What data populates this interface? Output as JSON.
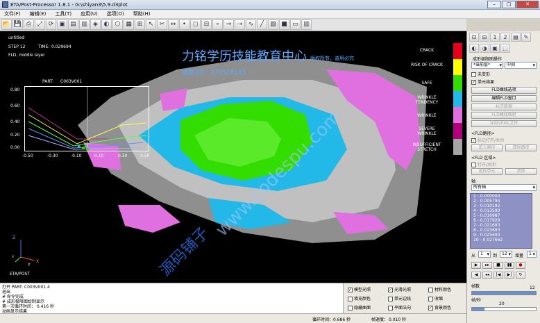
{
  "title": "ETA/Post-Processor 1.8.1 - G:\\shiyan3\\5.9.d3plot",
  "menu": [
    "文件(F)",
    "编辑(E)",
    "工具(T)",
    "应用(U)",
    "选项(O)",
    "帮助(H)"
  ],
  "toolbar_icons": [
    "open-icon",
    "save-icon",
    "print-icon",
    "zoom-fit-icon",
    "rotate-icon",
    "view-front-icon",
    "view-top-icon",
    "view-side-icon",
    "iso-view-icon",
    "shade-icon",
    "wireframe-icon",
    "grid-icon",
    "mesh-icon",
    "select-icon",
    "cut-icon",
    "measure-icon",
    "node-icon",
    "element-icon",
    "section-icon",
    "node2-icon",
    "vector-icon",
    "arrow-icon",
    "curve-icon",
    "line-icon",
    "fringe-icon",
    "color-icon",
    "plot-icon",
    "chart-icon"
  ],
  "viewport": {
    "model_name": "untitled",
    "step_label": "STEP 12",
    "time_label": "TIME:",
    "time_value": "0.029694",
    "result_label": "FLD, middle layer",
    "part_label": "PART:",
    "part_value": "C003V001",
    "axis_z": "Z",
    "axis_x": "X",
    "axis_y": "Y",
    "brand": "ETA/POST"
  },
  "fld_ticks_y": [
    "0.80",
    "0.60",
    "0.40",
    "0.20",
    "0.00"
  ],
  "fld_ticks_x": [
    "-0.50",
    "-0.30",
    "-0.10",
    "0.10",
    "0.30",
    "0.50"
  ],
  "legend": [
    {
      "label": "CRACK",
      "color": "#e8001a"
    },
    {
      "label": "RISK OF CRACK",
      "color": "#ffff00"
    },
    {
      "label": "SAFE",
      "color": "#33dd00"
    },
    {
      "label": "WRINKLE TENDENCY",
      "color": "#22b8e8"
    },
    {
      "label": "WRINKLE",
      "color": "#e070e0"
    },
    {
      "label": "SEVERE WRINKLE",
      "color": "#b0007a"
    },
    {
      "label": "INSUFFICIENT STRETCH",
      "color": "#a5a5a5"
    }
  ],
  "watermark": {
    "line1": "力铭学历技能教育中心",
    "line2": "销售QQ：470528185",
    "line3": "版权所有，盗用必究",
    "diag1": "www.codespu.com",
    "diag2": "源码铺子"
  },
  "right_panel": {
    "section_title": "成形极限图操作",
    "current_layer_select": "*当前层*",
    "layer_select": "中间",
    "unwarped": "未变形",
    "element_result": "单元结果",
    "btn_fld_options": "FLD曲线选项",
    "btn_edit_fld": "编辑FLD窗口",
    "btn_show_data": "标示数据",
    "btn_fld_map": "FLD曲线映射",
    "btn_export_vrml": "导出VRML文件",
    "fld_path_label": "<FLD路径>",
    "mark_toggle": "标记打开/关闭",
    "btn_define_path": "定义路径",
    "btn_clear_path": "清除路径",
    "fld_region_label": "<FLD 区域>",
    "open_toggle": "打开/关闭",
    "btn_select_element": "选择单元",
    "btn_remove": "清除",
    "axis_label": "轴",
    "axis_select": "所有轴",
    "list": [
      "1 -    0.000000",
      "2 -    0.005794",
      "3 -    0.010192",
      "4 -    0.013590",
      "5 -    0.016987",
      "6 -    0.017929",
      "7 -    0.021693",
      "8 -    0.023693",
      "9 -    0.025693",
      "10 -   0.027662"
    ],
    "frame_from_label": "从",
    "frame_from": "1",
    "frame_to_label": "到",
    "frame_to": "12",
    "frame_step_label": "增量",
    "frame_step": "1",
    "frames_label": "帧数",
    "frames_value": "12",
    "fps_label": "帧/秒",
    "fps_value": "20"
  },
  "cmd_log": [
    "打开 PART: C003V001 4",
    "退出",
    "# 命令完成",
    "# 成形极限图绘制显示",
    "第一次循环时间： 0.416 秒",
    "动画显示结果"
  ],
  "options": [
    {
      "label": "模型光照",
      "checked": true
    },
    {
      "label": "光滑光照",
      "checked": true
    },
    {
      "label": "材料颜色",
      "checked": false
    },
    {
      "label": "填充颜色",
      "checked": false
    },
    {
      "label": "单元边线",
      "checked": false
    },
    {
      "label": "收缩",
      "checked": false
    },
    {
      "label": "隐藏曲面",
      "checked": false
    },
    {
      "label": "平面法向",
      "checked": false
    },
    {
      "label": "背景颜色",
      "checked": true
    }
  ],
  "status": {
    "loop_label": "循环时间：",
    "loop_value": "0.686 秒",
    "frame_label": "帧速度：",
    "frame_value": "0.010 秒"
  }
}
